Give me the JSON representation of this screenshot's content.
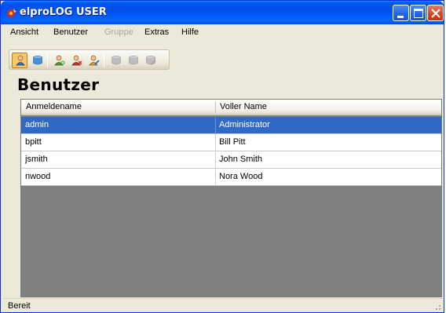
{
  "window": {
    "title": "elproLOG USER"
  },
  "menu": {
    "items": [
      {
        "label": "Ansicht",
        "disabled": false
      },
      {
        "label": "Benutzer",
        "disabled": false
      },
      {
        "label": "Gruppe",
        "disabled": true
      },
      {
        "label": "Extras",
        "disabled": false
      },
      {
        "label": "Hilfe",
        "disabled": false
      }
    ]
  },
  "toolbar": {
    "buttons": [
      {
        "icon": "users-view-icon",
        "active": true,
        "enabled": true
      },
      {
        "icon": "groups-view-icon",
        "active": false,
        "enabled": true
      },
      {
        "icon": "add-user-icon",
        "active": false,
        "enabled": true
      },
      {
        "icon": "delete-user-icon",
        "active": false,
        "enabled": true
      },
      {
        "icon": "edit-user-icon",
        "active": false,
        "enabled": true
      },
      {
        "icon": "add-group-icon",
        "active": false,
        "enabled": false
      },
      {
        "icon": "delete-group-icon",
        "active": false,
        "enabled": false
      },
      {
        "icon": "edit-group-icon",
        "active": false,
        "enabled": false
      }
    ]
  },
  "main": {
    "title": "Benutzer"
  },
  "grid": {
    "columns": [
      "Anmeldename",
      "Voller Name"
    ],
    "rows": [
      {
        "login": "admin",
        "fullname": "Administrator",
        "selected": true
      },
      {
        "login": "bpitt",
        "fullname": "Bill Pitt",
        "selected": false
      },
      {
        "login": "jsmith",
        "fullname": "John Smith",
        "selected": false
      },
      {
        "login": "nwood",
        "fullname": "Nora Wood",
        "selected": false
      }
    ]
  },
  "status": {
    "text": "Bereit"
  },
  "colors": {
    "selection": "#316ac5",
    "titlebar": "#0053ee",
    "grid_background": "#808080",
    "window_background": "#ece9d8"
  }
}
